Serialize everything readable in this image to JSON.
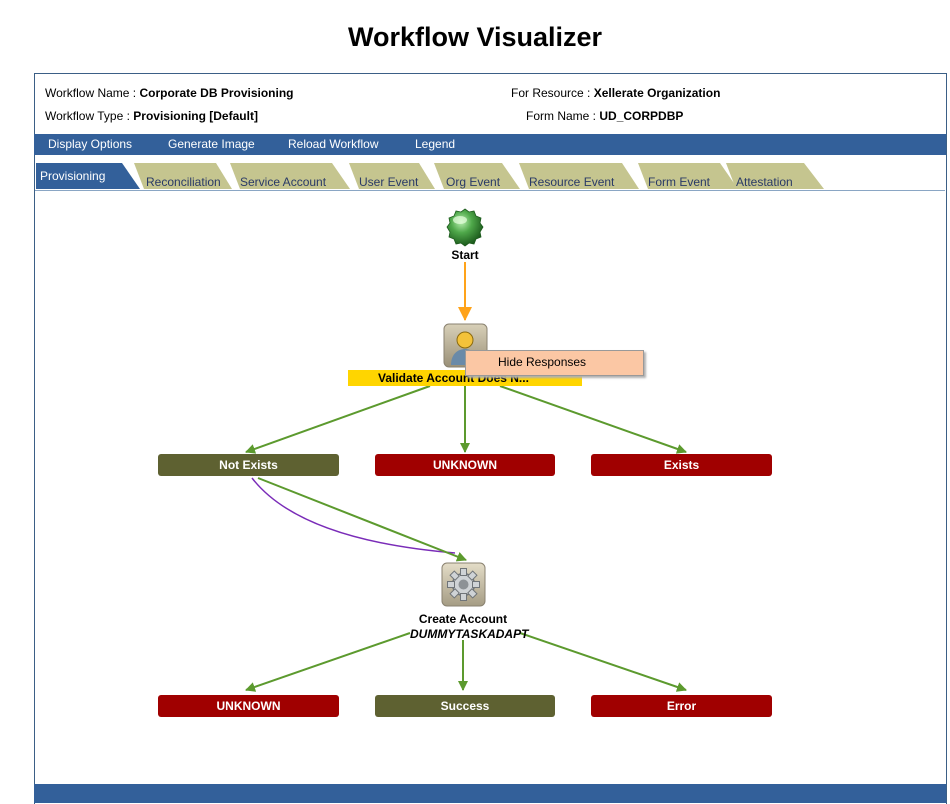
{
  "page": {
    "title": "Workflow Visualizer"
  },
  "info": {
    "workflow_name_label": "Workflow Name :",
    "workflow_name": "Corporate DB Provisioning",
    "workflow_type_label": "Workflow Type :",
    "workflow_type": "Provisioning [Default]",
    "resource_label": "For Resource :",
    "resource": "Xellerate Organization",
    "form_label": "Form Name :",
    "form": "UD_CORPDBP"
  },
  "menu": [
    "Display Options",
    "Generate Image",
    "Reload Workflow",
    "Legend"
  ],
  "tabs": [
    "Provisioning",
    "Reconciliation",
    "Service Account",
    "User Event",
    "Org Event",
    "Resource Event",
    "Form Event",
    "Attestation"
  ],
  "active_tab": "Provisioning",
  "workflow": {
    "start": {
      "label": "Start"
    },
    "task1": {
      "label": "Validate Account Does N..."
    },
    "context_menu": {
      "item": "Hide Responses"
    },
    "responses1": {
      "not_exists": "Not Exists",
      "unknown": "UNKNOWN",
      "exists": "Exists"
    },
    "task2": {
      "label": "Create Account",
      "adapter": "DUMMYTASKADAPT"
    },
    "responses2": {
      "unknown": "UNKNOWN",
      "success": "Success",
      "error": "Error"
    }
  },
  "colors": {
    "menubar": "#33609a",
    "tab": "#c5c58f",
    "tab_active": "#33609a",
    "response_green": "#5e6131",
    "response_red": "#a00000",
    "task_highlight": "#ffd500",
    "start_arrow": "#ffa31a",
    "arrow": "#5c9a2e",
    "context_menu": "#fbc7a4"
  }
}
